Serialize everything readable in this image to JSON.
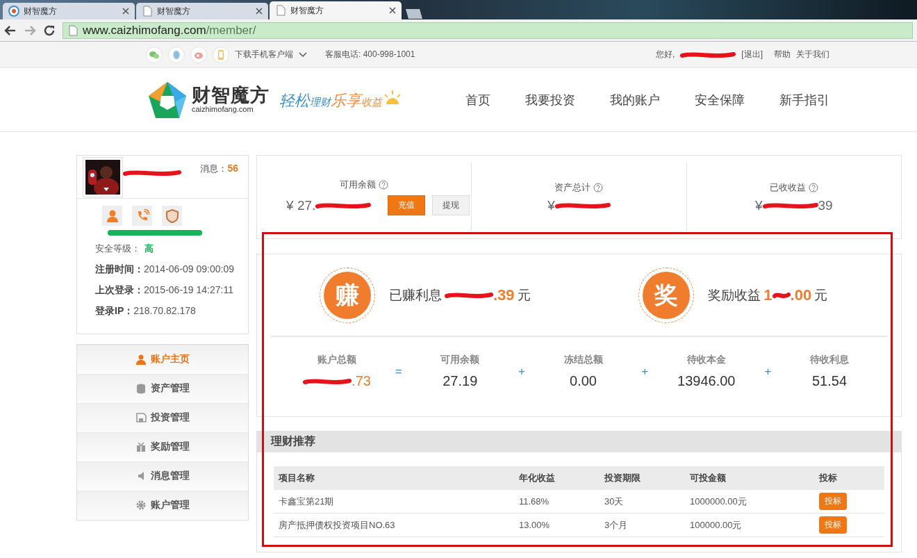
{
  "browser": {
    "tabs": [
      {
        "title": "财智魔方",
        "kind": "site",
        "selected": false
      },
      {
        "title": "财智魔方",
        "kind": "page",
        "selected": false
      },
      {
        "title": "财智魔方",
        "kind": "page",
        "selected": true
      }
    ],
    "url": {
      "host": "www.caizhimofang.com",
      "path": "/member/"
    }
  },
  "topbar": {
    "download": "下载手机客户端",
    "hotline": "客服电话: 400-998-1001",
    "greeting": "您好,",
    "logout": "[退出]",
    "links": [
      "帮助",
      "关于我们"
    ]
  },
  "header": {
    "logo_name": "财智魔方",
    "logo_domain": "caizhimofang.com",
    "slogan": [
      {
        "text": "轻松",
        "kind": "big",
        "color": "#3a8fd0"
      },
      {
        "text": "理财",
        "kind": "small",
        "color": "#3a8fd0"
      },
      {
        "text": "乐享",
        "kind": "big",
        "color": "#f08a3c"
      },
      {
        "text": "收益",
        "kind": "small",
        "color": "#f08a3c"
      }
    ],
    "nav": [
      "首页",
      "我要投资",
      "我的账户",
      "安全保障",
      "新手指引"
    ]
  },
  "profile": {
    "messages_label": "消息：",
    "messages_count": "56",
    "security": {
      "level": 1
    },
    "security_label": "安全等级：",
    "security_value": "高",
    "info": [
      {
        "label": "注册时间：",
        "value": "2014-06-09 09:00:09"
      },
      {
        "label": "上次登录：",
        "value": "2015-06-19 14:27:11"
      },
      {
        "label": "登录IP：",
        "value": "218.70.82.178"
      }
    ]
  },
  "menu": [
    {
      "label": "账户主页",
      "kind": "person",
      "selected": true
    },
    {
      "label": "资产管理",
      "kind": "coins",
      "selected": false
    },
    {
      "label": "投资管理",
      "kind": "disk",
      "selected": false
    },
    {
      "label": "奖励管理",
      "kind": "gift",
      "selected": false
    },
    {
      "label": "消息管理",
      "kind": "speaker",
      "selected": false
    },
    {
      "label": "账户管理",
      "kind": "gear",
      "selected": false
    }
  ],
  "summary": [
    {
      "label": "可用余额",
      "prefix": "¥ 27.",
      "redacted": true,
      "buttons": [
        {
          "label": "充值",
          "kind": "primary"
        },
        {
          "label": "提现",
          "kind": "secondary"
        }
      ]
    },
    {
      "label": "资产总计",
      "prefix": "¥",
      "redacted": true
    },
    {
      "label": "已收收益",
      "prefix": "¥",
      "redacted": true,
      "suffix": "39"
    }
  ],
  "earnings": [
    {
      "badge": "赚",
      "label": "已赚利息",
      "redacted": true,
      "suffix": ".39",
      "unit": "元"
    },
    {
      "badge": "奖",
      "label": "奖励收益",
      "prefix": "1",
      "redacted": true,
      "suffix": ".00",
      "unit": "元"
    }
  ],
  "breakdown": [
    {
      "kind": "amount",
      "label": "账户总额",
      "redacted": true,
      "suffix": ".73",
      "accent": true
    },
    {
      "kind": "operator",
      "text": "="
    },
    {
      "kind": "amount",
      "label": "可用余额",
      "prefix": "27.19"
    },
    {
      "kind": "operator",
      "text": "+"
    },
    {
      "kind": "amount",
      "label": "冻结总额",
      "prefix": "0.00"
    },
    {
      "kind": "operator",
      "text": "+"
    },
    {
      "kind": "amount",
      "label": "待收本金",
      "prefix": "13946.00"
    },
    {
      "kind": "operator",
      "text": "+"
    },
    {
      "kind": "amount",
      "label": "待收利息",
      "prefix": "51.54"
    }
  ],
  "recommend": {
    "title": "理财推荐",
    "columns": [
      "项目名称",
      "年化收益",
      "投资期限",
      "可投金额",
      "投标"
    ],
    "rows": [
      {
        "cells": [
          "卡鑫宝第21期",
          "11.68%",
          "30天",
          "1000000.00元"
        ],
        "action": "投标"
      },
      {
        "cells": [
          "房产抵押债权投资项目NO.63",
          "13.00%",
          "3个月",
          "100000.00元"
        ],
        "action": "投标"
      }
    ]
  },
  "annotation": {
    "highlight_box": true
  }
}
